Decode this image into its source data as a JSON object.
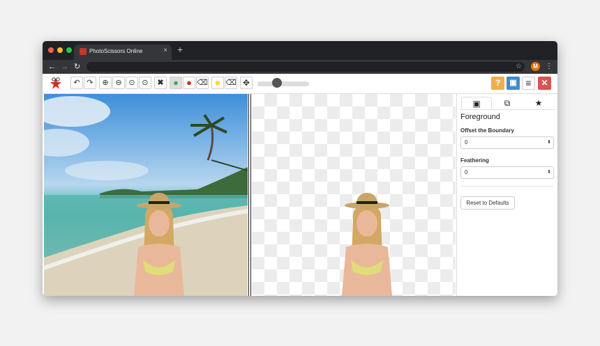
{
  "browser": {
    "tab_title": "PhotoScissors Online",
    "tab_close": "×",
    "new_tab": "+",
    "back": "←",
    "forward": "→",
    "reload": "↻",
    "bookmark": "☆",
    "avatar_letter": "M",
    "menu": "⋮"
  },
  "toolbar": {
    "logo": "app-logo",
    "undo": "↶",
    "redo": "↷",
    "zoom_in": "⊕",
    "zoom_out": "⊖",
    "zoom_actual": "⊙",
    "zoom_fit": "⊙",
    "clear": "✖",
    "keep_marker": "●",
    "remove_marker": "●",
    "eraser": "⌫",
    "hair_marker": "●",
    "hair_eraser": "⌫",
    "move": "✥",
    "marker_size_level": 0.35,
    "help": "?",
    "save": "▣",
    "menu": "≡",
    "close": "✕"
  },
  "colors": {
    "help": "#f0ad4e",
    "save": "#428bca",
    "close": "#d9534f",
    "keep_marker": "#3cb043",
    "remove_marker": "#d62a20",
    "hair_marker": "#ffe000"
  },
  "panel": {
    "tabs": [
      {
        "icon": "foreground-icon",
        "glyph": "▣"
      },
      {
        "icon": "background-icon",
        "glyph": "⧉"
      },
      {
        "icon": "star-icon",
        "glyph": "★"
      }
    ],
    "title": "Foreground",
    "offset_label": "Offset the Boundary",
    "offset_value": "0",
    "feathering_label": "Feathering",
    "feathering_value": "0",
    "spinner": "⬍",
    "reset_label": "Reset to Defaults"
  }
}
